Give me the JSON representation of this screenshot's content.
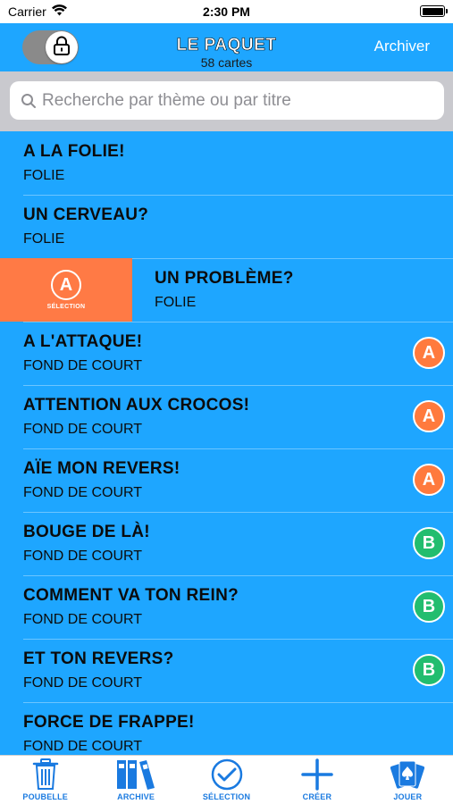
{
  "status_bar": {
    "carrier": "Carrier",
    "time": "2:30 PM"
  },
  "nav": {
    "title": "LE PAQUET",
    "subtitle": "58 cartes",
    "action": "Archiver",
    "lock_icon": "lock-icon"
  },
  "search": {
    "placeholder": "Recherche par thème ou par titre",
    "value": ""
  },
  "swipe_action": {
    "letter": "A",
    "label": "SÉLECTION"
  },
  "rows": [
    {
      "title": "A LA FOLIE!",
      "subtitle": "FOLIE",
      "badge": ""
    },
    {
      "title": "UN CERVEAU?",
      "subtitle": "FOLIE",
      "badge": ""
    },
    {
      "title": "UN PROBLÈME?",
      "subtitle": "FOLIE",
      "badge": ""
    },
    {
      "title": "A L'ATTAQUE!",
      "subtitle": "FOND DE COURT",
      "badge": "A"
    },
    {
      "title": "ATTENTION AUX CROCOS!",
      "subtitle": "FOND DE COURT",
      "badge": "A"
    },
    {
      "title": "AÏE MON REVERS!",
      "subtitle": "FOND DE COURT",
      "badge": "A"
    },
    {
      "title": "BOUGE DE LÀ!",
      "subtitle": "FOND DE COURT",
      "badge": "B"
    },
    {
      "title": "COMMENT VA TON REIN?",
      "subtitle": "FOND DE COURT",
      "badge": "B"
    },
    {
      "title": "ET TON REVERS?",
      "subtitle": "FOND DE COURT",
      "badge": "B"
    },
    {
      "title": "FORCE DE FRAPPE!",
      "subtitle": "FOND DE COURT",
      "badge": ""
    }
  ],
  "tabs": [
    {
      "label": "POUBELLE",
      "icon": "trash-icon"
    },
    {
      "label": "ARCHIVE",
      "icon": "binders-icon"
    },
    {
      "label": "SÉLECTION",
      "icon": "checkmark-circle-icon"
    },
    {
      "label": "CRÉER",
      "icon": "plus-icon"
    },
    {
      "label": "JOUER",
      "icon": "playing-cards-icon"
    }
  ],
  "colors": {
    "primary": "#1ea6ff",
    "badge_a": "#ff7a3d",
    "badge_b": "#22bd6f",
    "swipe_action": "#ff7a45",
    "tab_tint": "#1a7ae0"
  }
}
